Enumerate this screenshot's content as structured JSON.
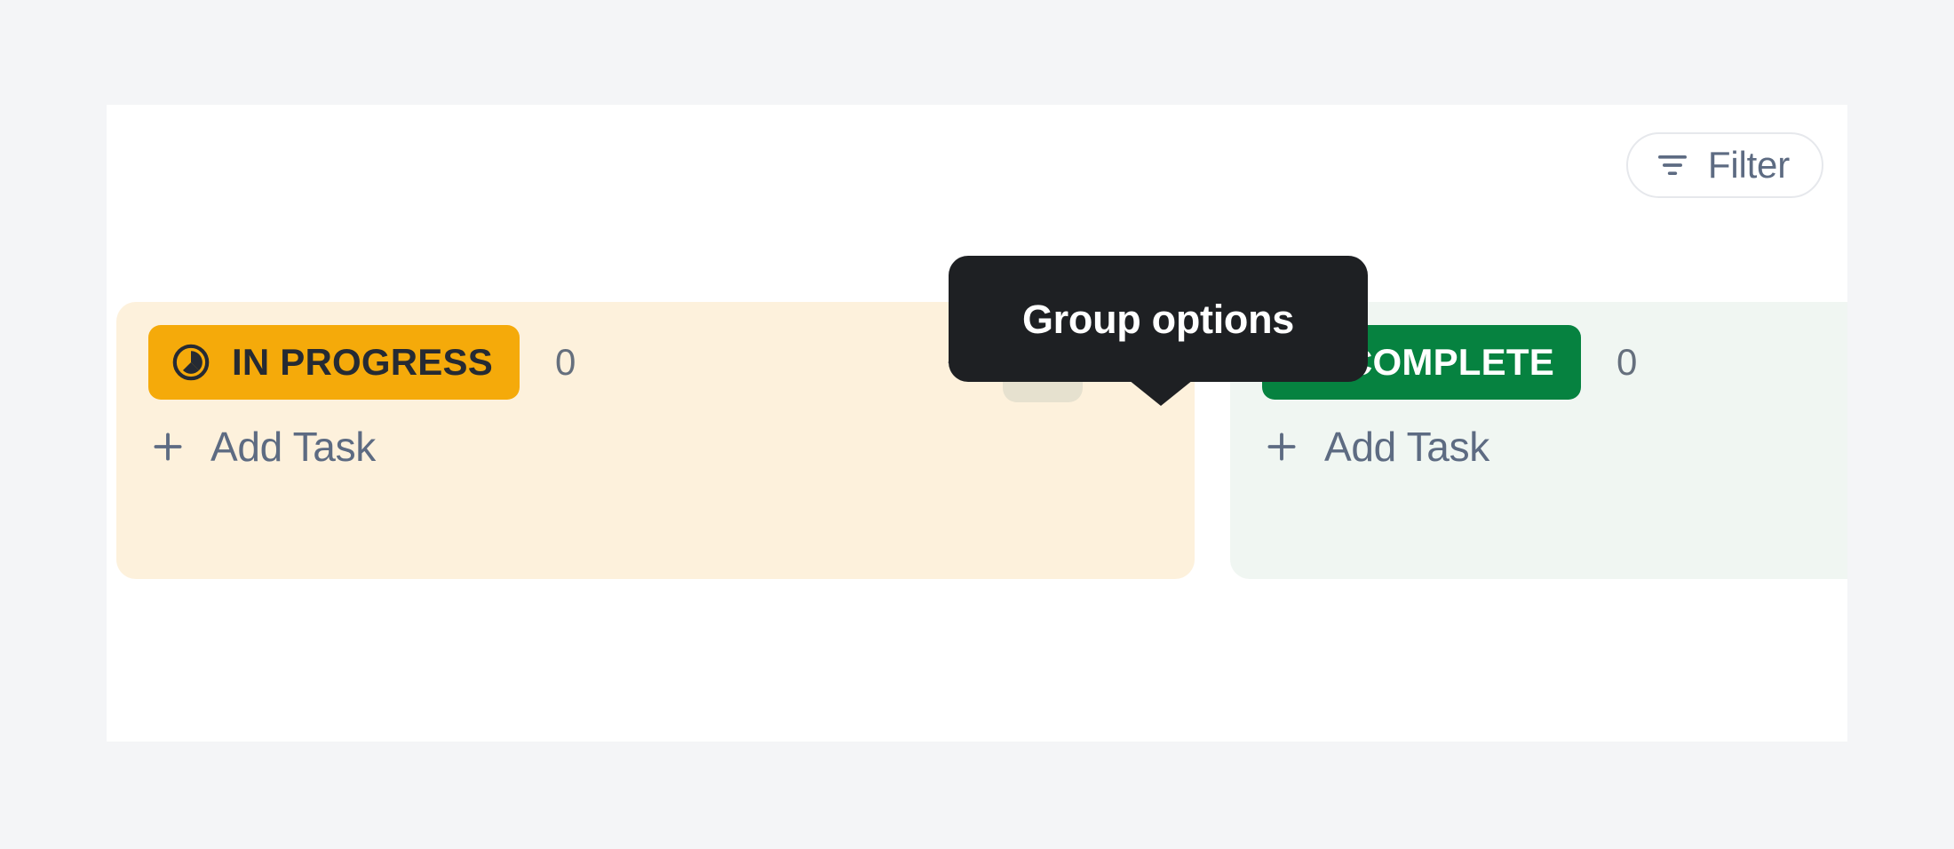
{
  "colors": {
    "page_background": "#F4F5F7",
    "panel_background": "#FFFFFF",
    "in_progress_column_bg": "#FDF1DC",
    "in_progress_badge": "#F5AA0A",
    "in_progress_badge_text": "#252A33",
    "complete_column_bg": "#F0F6F2",
    "complete_badge": "#068240",
    "complete_badge_text": "#FFFFFF",
    "muted_text": "#5D6B82",
    "count_text": "#656F7D",
    "tooltip_background": "#1E2023",
    "tooltip_text": "#FFFFFF",
    "hover_button_bg": "#E6E1CF",
    "filter_border": "#E6E8EC"
  },
  "toolbar": {
    "filter": {
      "label": "Filter",
      "icon": "filter-icon"
    }
  },
  "tooltip": {
    "text": "Group options",
    "target": "group-options-button"
  },
  "columns": [
    {
      "id": "in-progress",
      "status_label": "IN PROGRESS",
      "status_icon": "clock-progress-icon",
      "task_count": "0",
      "add_task_label": "Add Task",
      "add_task_icon": "plus-icon",
      "actions": [
        {
          "name": "collapse-group-button",
          "icon": "chevron-left-icon",
          "hovered": false
        },
        {
          "name": "group-options-button",
          "icon": "ellipsis-icon",
          "hovered": true
        },
        {
          "name": "add-task-header-button",
          "icon": "plus-icon",
          "hovered": false
        }
      ]
    },
    {
      "id": "complete",
      "status_label": "COMPLETE",
      "status_icon": "check-circle-icon",
      "task_count": "0",
      "add_task_label": "Add Task",
      "add_task_icon": "plus-icon",
      "actions": []
    }
  ]
}
